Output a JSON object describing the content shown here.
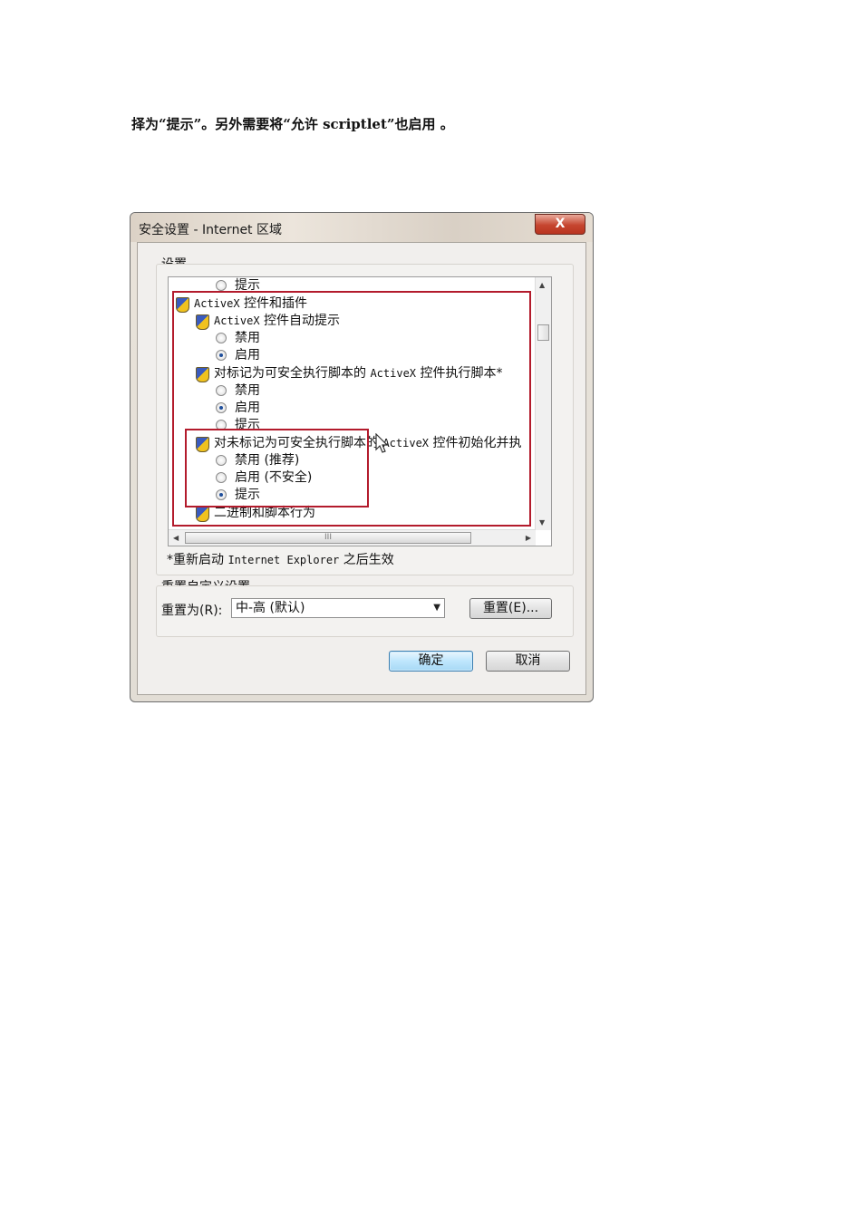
{
  "document": {
    "line": "择为“提示”。另外需要将“允许 scriptlet”也启用 。"
  },
  "dialog": {
    "title": "安全设置 - Internet 区域",
    "close_glyph": "X",
    "settings_group_label": "设置",
    "tree": [
      {
        "type": "radio",
        "label": "提示",
        "checked": false
      },
      {
        "type": "category",
        "label_prefix": "ActiveX",
        "label": " 控件和插件"
      },
      {
        "type": "setting",
        "label_prefix": "ActiveX",
        "label": " 控件自动提示"
      },
      {
        "type": "radio",
        "label": "禁用",
        "checked": false
      },
      {
        "type": "radio",
        "label": "启用",
        "checked": true
      },
      {
        "type": "setting",
        "label": "对标记为可安全执行脚本的 ",
        "label_mono": "ActiveX",
        "label_tail": " 控件执行脚本*"
      },
      {
        "type": "radio",
        "label": "禁用",
        "checked": false
      },
      {
        "type": "radio",
        "label": "启用",
        "checked": true
      },
      {
        "type": "radio",
        "label": "提示",
        "checked": false
      },
      {
        "type": "setting",
        "label": "对未标记为可安全执行脚本的 ",
        "label_mono": "ActiveX",
        "label_tail": " 控件初始化并执"
      },
      {
        "type": "radio",
        "label": "禁用 (推荐)",
        "checked": false
      },
      {
        "type": "radio",
        "label": "启用 (不安全)",
        "checked": false
      },
      {
        "type": "radio",
        "label": "提示",
        "checked": true
      },
      {
        "type": "setting",
        "label": "二进制和脚本行为"
      }
    ],
    "restart_note_prefix": "*重新启动 ",
    "restart_note_mono": "Internet Explorer",
    "restart_note_suffix": " 之后生效",
    "reset_group_label": "重置自定义设置",
    "reset_to_label": "重置为(R):",
    "reset_to_value": "中-高 (默认)",
    "reset_button": "重置(E)...",
    "ok_button": "确定",
    "cancel_button": "取消",
    "scrollbar_h_grip": "III",
    "highlight_color": "#b31b2c"
  }
}
